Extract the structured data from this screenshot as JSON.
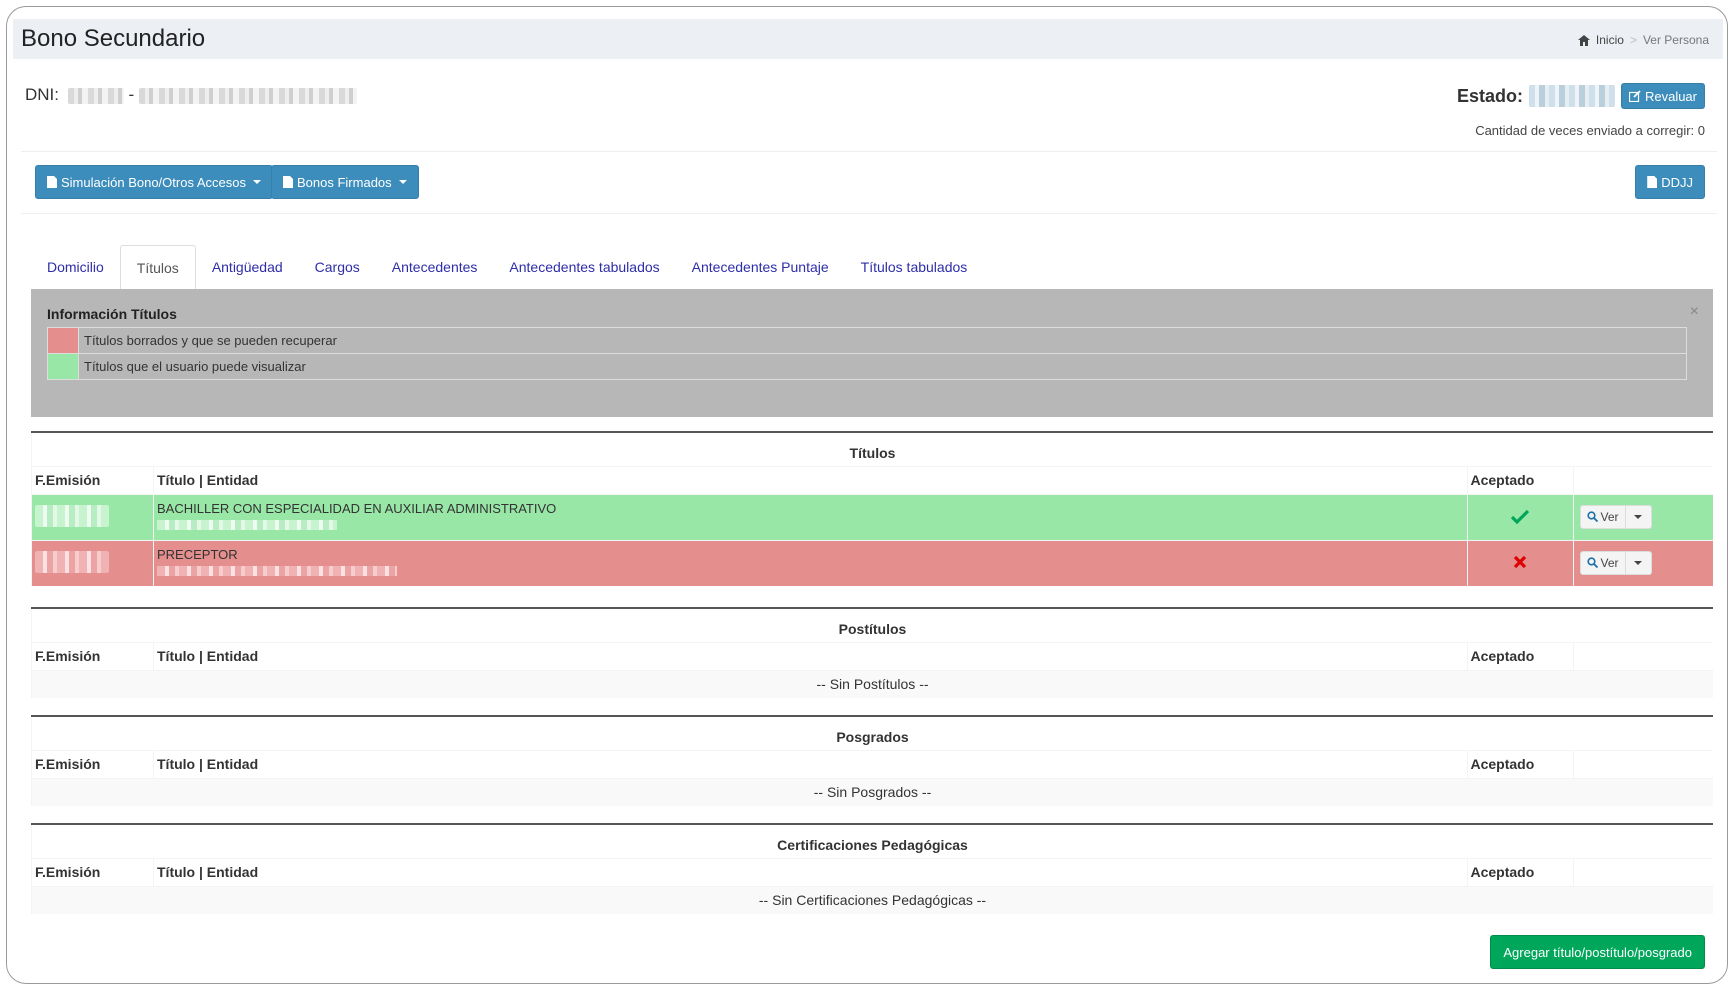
{
  "header": {
    "title": "Bono Secundario",
    "breadcrumb": {
      "home": "Inicio",
      "separator": ">",
      "current": "Ver Persona"
    }
  },
  "person": {
    "dni_label": "DNI:",
    "dni_dash": "-",
    "estado_label": "Estado:",
    "revaluar_label": "Revaluar",
    "cantidad_text": "Cantidad de veces enviado a corregir: 0"
  },
  "toolbar": {
    "simulacion_label": "Simulación Bono/Otros Accesos",
    "bonos_firmados_label": "Bonos Firmados",
    "ddjj_label": "DDJJ"
  },
  "tabs": [
    {
      "label": "Domicilio",
      "active": false
    },
    {
      "label": "Títulos",
      "active": true
    },
    {
      "label": "Antigüedad",
      "active": false
    },
    {
      "label": "Cargos",
      "active": false
    },
    {
      "label": "Antecedentes",
      "active": false
    },
    {
      "label": "Antecedentes tabulados",
      "active": false
    },
    {
      "label": "Antecedentes Puntaje",
      "active": false
    },
    {
      "label": "Títulos tabulados",
      "active": false
    }
  ],
  "info_box": {
    "title": "Información Títulos",
    "close": "×",
    "legend": [
      {
        "color": "#e48e8e",
        "text": "Títulos borrados y que se pueden recuperar"
      },
      {
        "color": "#98e7a6",
        "text": "Títulos que el usuario puede visualizar"
      }
    ]
  },
  "columns": {
    "fecha": "F.Emisión",
    "titulo": "Título | Entidad",
    "aceptado": "Aceptado"
  },
  "sections": {
    "titulos": {
      "heading": "Títulos",
      "rows": [
        {
          "titulo": "BACHILLER CON ESPECIALIDAD EN AUXILIAR ADMINISTRATIVO",
          "aceptado": true,
          "ver_label": "Ver"
        },
        {
          "titulo": "PRECEPTOR",
          "aceptado": false,
          "ver_label": "Ver"
        }
      ]
    },
    "postitulos": {
      "heading": "Postítulos",
      "empty": "-- Sin Postítulos --"
    },
    "posgrados": {
      "heading": "Posgrados",
      "empty": "-- Sin Posgrados --"
    },
    "certificaciones": {
      "heading": "Certificaciones Pedagógicas",
      "empty": "-- Sin Certificaciones Pedagógicas --"
    }
  },
  "footer": {
    "add_label": "Agregar título/postítulo/posgrado"
  },
  "colors": {
    "primary": "#3c8dbc",
    "success": "#00a65a",
    "row_green": "#98e7a6",
    "row_red": "#e48e8e",
    "check": "#00a65a",
    "cross": "#dd0000"
  }
}
